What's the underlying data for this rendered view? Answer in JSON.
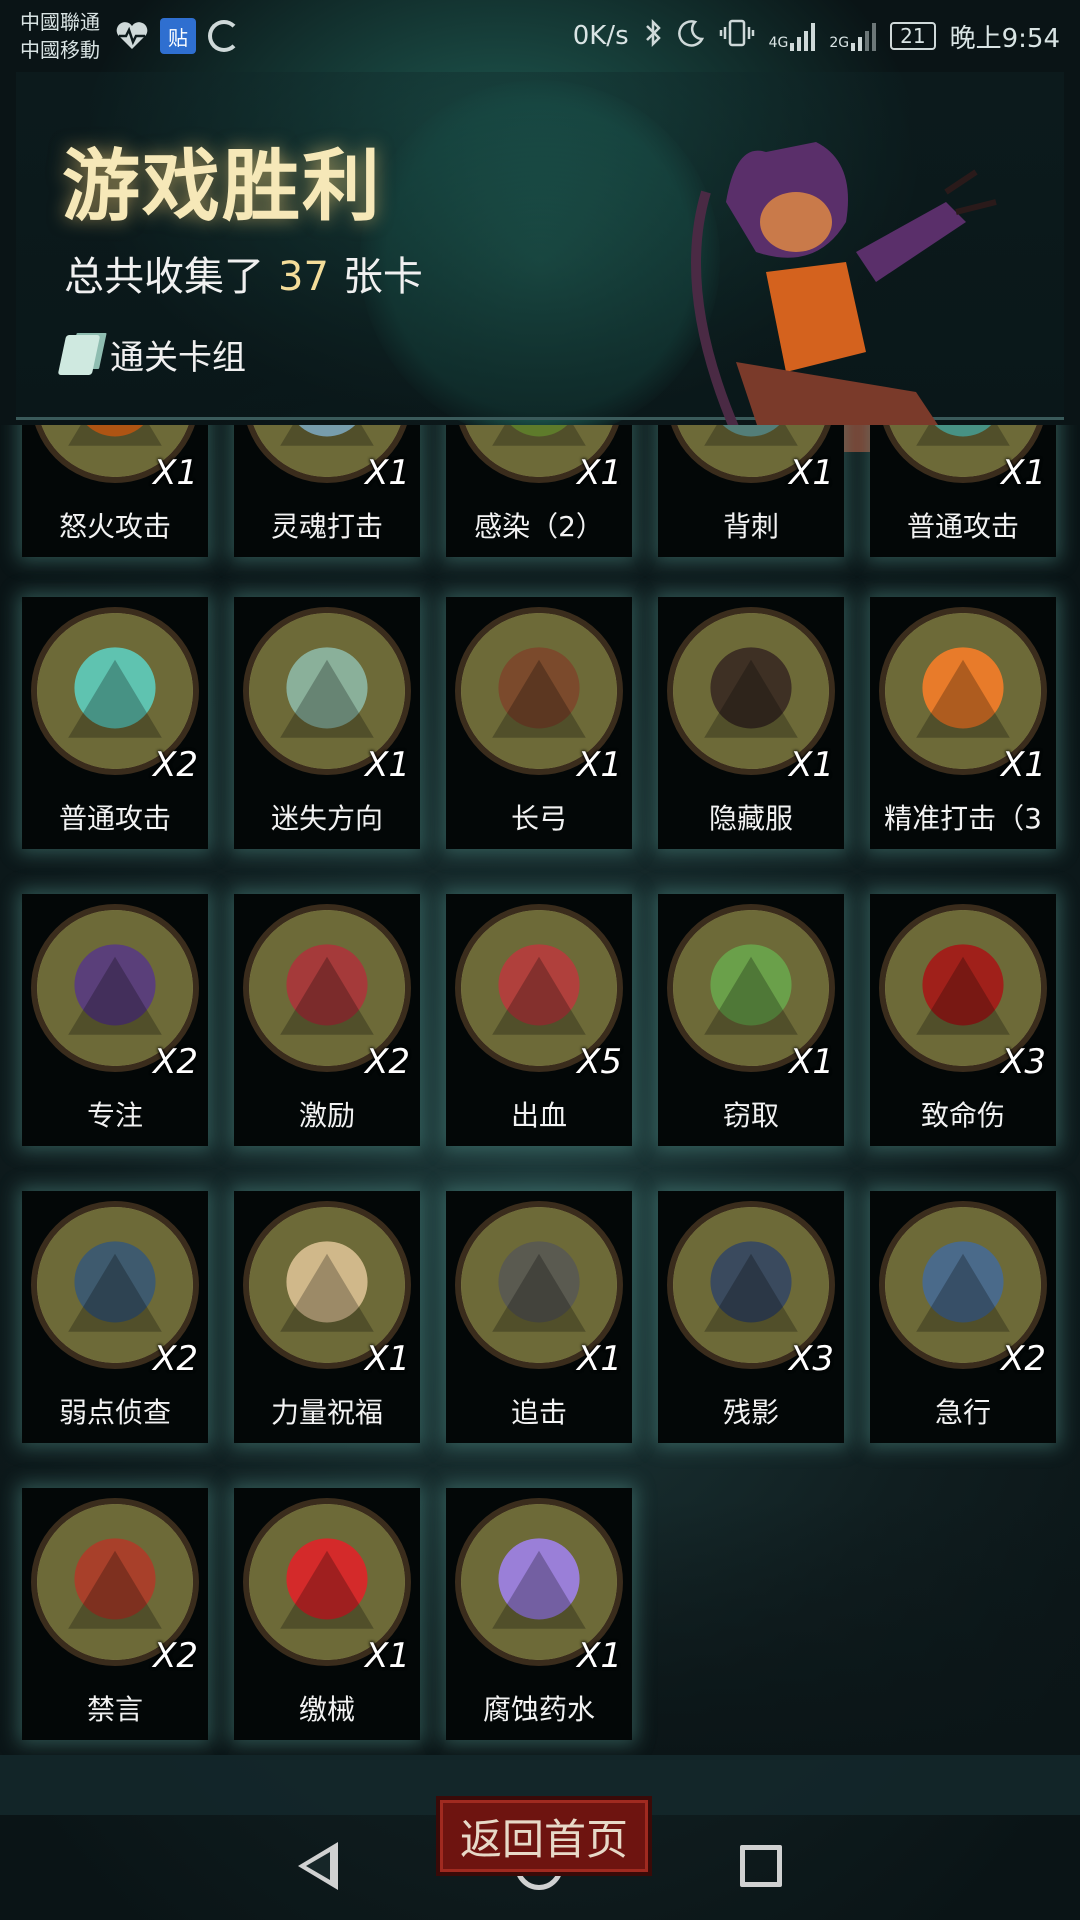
{
  "status_bar": {
    "carrier_1": "中國聯通",
    "carrier_2": "中國移動",
    "net_speed": "0K/s",
    "signal_1": "4G",
    "signal_2": "2G",
    "battery": "21",
    "time": "晚上9:54",
    "icons": [
      "heart-rate-icon",
      "tieba-icon",
      "loading-icon",
      "bluetooth-icon",
      "moon-icon",
      "vibrate-icon",
      "signal-icon",
      "battery-icon"
    ]
  },
  "header": {
    "title": "游戏胜利",
    "summary_prefix": "总共收集了",
    "summary_count": "37",
    "summary_suffix": "张卡",
    "deck_button_label": "通关卡组"
  },
  "cards": [
    {
      "name": "怒火攻击",
      "qty": "X1",
      "color": "#e8701a"
    },
    {
      "name": "灵魂打击",
      "qty": "X1",
      "color": "#9fd2e6"
    },
    {
      "name": "感染（2）",
      "qty": "X1",
      "color": "#7ea53a"
    },
    {
      "name": "背刺",
      "qty": "X1",
      "color": "#6fa9a0"
    },
    {
      "name": "普通攻击",
      "qty": "X1",
      "color": "#5fc3b0"
    },
    {
      "name": "普通攻击",
      "qty": "X2",
      "color": "#5fc3b0"
    },
    {
      "name": "迷失方向",
      "qty": "X1",
      "color": "#8ab09a"
    },
    {
      "name": "长弓",
      "qty": "X1",
      "color": "#7b4a2c"
    },
    {
      "name": "隐藏服",
      "qty": "X1",
      "color": "#3e3024"
    },
    {
      "name": "精准打击（3",
      "qty": "X1",
      "color": "#e87b2a"
    },
    {
      "name": "专注",
      "qty": "X2",
      "color": "#5a3f7a"
    },
    {
      "name": "激励",
      "qty": "X2",
      "color": "#a53a3a"
    },
    {
      "name": "出血",
      "qty": "X5",
      "color": "#b0403c"
    },
    {
      "name": "窃取",
      "qty": "X1",
      "color": "#6aa04a"
    },
    {
      "name": "致命伤",
      "qty": "X3",
      "color": "#a0201a"
    },
    {
      "name": "弱点侦查",
      "qty": "X2",
      "color": "#3e5a6e"
    },
    {
      "name": "力量祝福",
      "qty": "X1",
      "color": "#d0b88a"
    },
    {
      "name": "追击",
      "qty": "X1",
      "color": "#5a5a50"
    },
    {
      "name": "残影",
      "qty": "X3",
      "color": "#3a4a5e"
    },
    {
      "name": "急行",
      "qty": "X2",
      "color": "#4a6a8a"
    },
    {
      "name": "禁言",
      "qty": "X2",
      "color": "#a8402a"
    },
    {
      "name": "缴械",
      "qty": "X1",
      "color": "#d42a2a"
    },
    {
      "name": "腐蚀药水",
      "qty": "X1",
      "color": "#9a7fd8"
    }
  ],
  "footer": {
    "home_button_label": "返回首页"
  },
  "colors": {
    "title_gold": "#f6e8b8",
    "count_gold": "#f4dd9a",
    "card_bg": "#030707",
    "card_glow": "#5aa096",
    "disc_fill": "#6d6a38",
    "home_button_red": "#6e1410"
  }
}
